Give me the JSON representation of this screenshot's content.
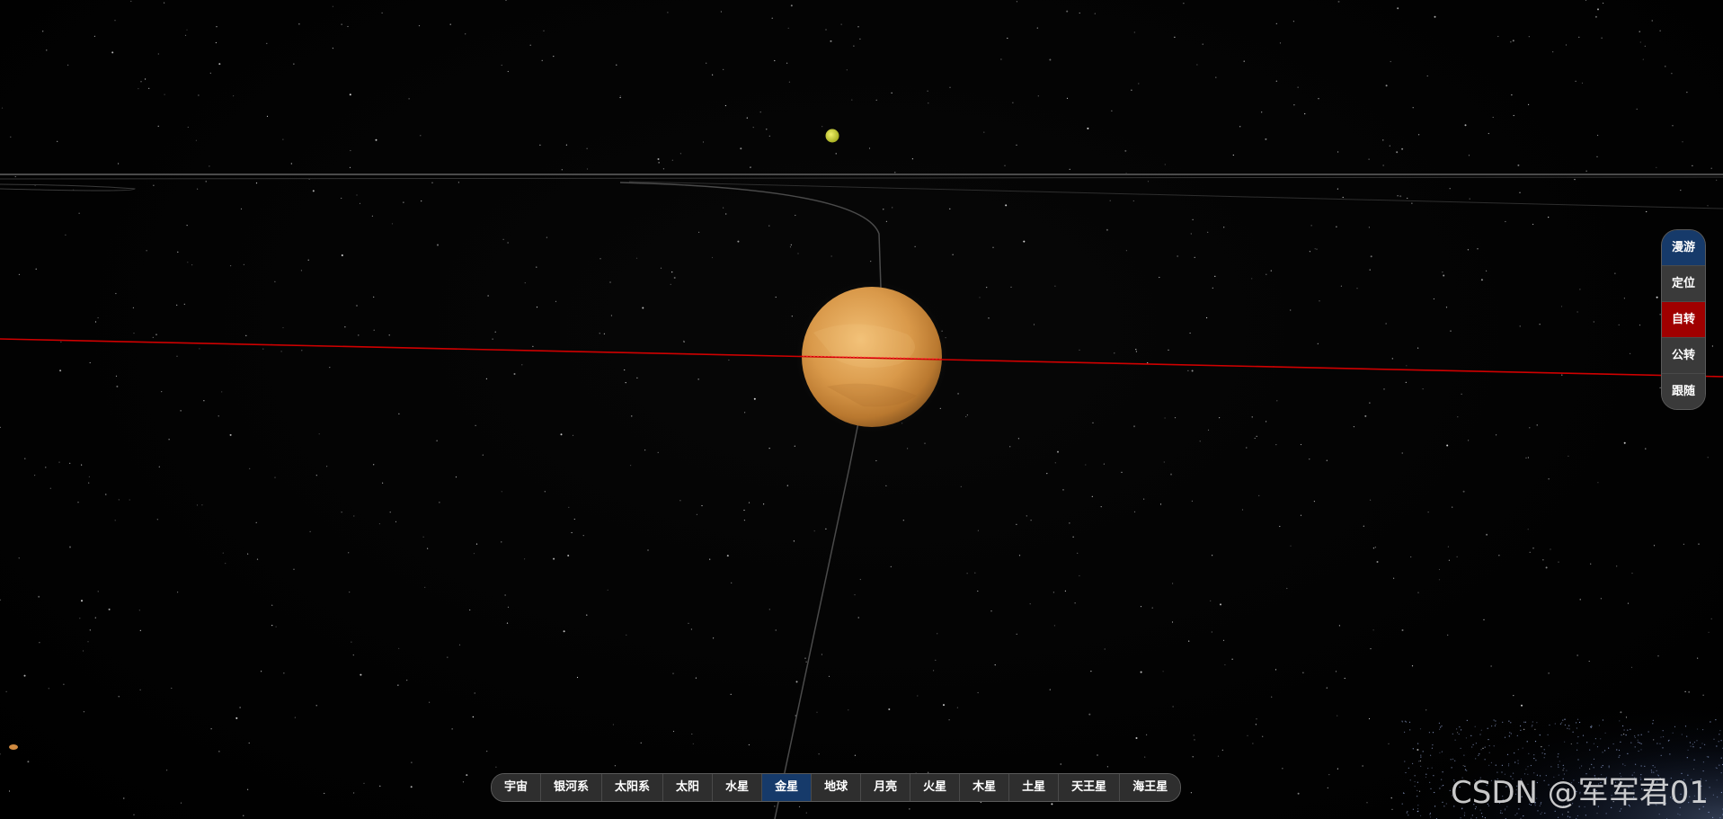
{
  "scene": {
    "focused_body": "金星",
    "icons": [
      "venus-planet-icon",
      "small-yellow-planet-icon",
      "small-orange-planet-icon"
    ],
    "colors": {
      "background": "#030303",
      "venus": "#e0a455",
      "axis_line": "#d00000",
      "orbit_line": "#5a5a5a"
    }
  },
  "bottom_nav": {
    "items": [
      {
        "label": "宇宙",
        "active": false
      },
      {
        "label": "银河系",
        "active": false
      },
      {
        "label": "太阳系",
        "active": false
      },
      {
        "label": "太阳",
        "active": false
      },
      {
        "label": "水星",
        "active": false
      },
      {
        "label": "金星",
        "active": true
      },
      {
        "label": "地球",
        "active": false
      },
      {
        "label": "月亮",
        "active": false
      },
      {
        "label": "火星",
        "active": false
      },
      {
        "label": "木星",
        "active": false
      },
      {
        "label": "土星",
        "active": false
      },
      {
        "label": "天王星",
        "active": false
      },
      {
        "label": "海王星",
        "active": false
      }
    ],
    "active_color": "#163a6a"
  },
  "side_panel": {
    "items": [
      {
        "label": "漫游",
        "state": "selected"
      },
      {
        "label": "定位",
        "state": "normal"
      },
      {
        "label": "自转",
        "state": "on"
      },
      {
        "label": "公转",
        "state": "normal"
      },
      {
        "label": "跟随",
        "state": "normal"
      }
    ],
    "selected_color": "#163a6a",
    "on_color": "#a00000"
  },
  "watermark": {
    "text": "CSDN @军军君01"
  }
}
